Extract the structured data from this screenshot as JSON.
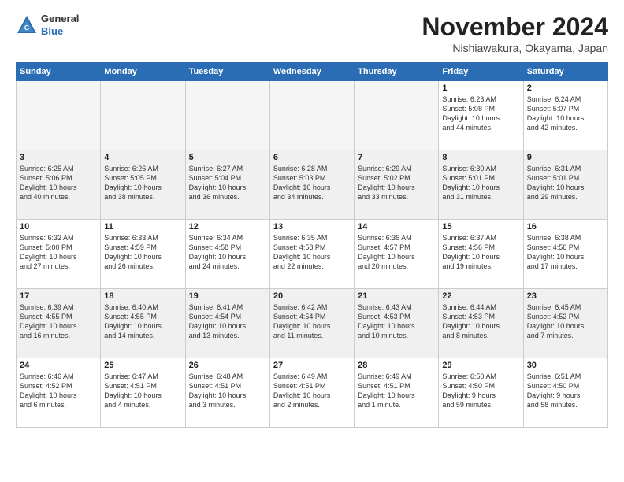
{
  "header": {
    "logo_line1": "General",
    "logo_line2": "Blue",
    "month_title": "November 2024",
    "location": "Nishiawakura, Okayama, Japan"
  },
  "weekdays": [
    "Sunday",
    "Monday",
    "Tuesday",
    "Wednesday",
    "Thursday",
    "Friday",
    "Saturday"
  ],
  "weeks": [
    [
      {
        "day": "",
        "text": ""
      },
      {
        "day": "",
        "text": ""
      },
      {
        "day": "",
        "text": ""
      },
      {
        "day": "",
        "text": ""
      },
      {
        "day": "",
        "text": ""
      },
      {
        "day": "1",
        "text": "Sunrise: 6:23 AM\nSunset: 5:08 PM\nDaylight: 10 hours\nand 44 minutes."
      },
      {
        "day": "2",
        "text": "Sunrise: 6:24 AM\nSunset: 5:07 PM\nDaylight: 10 hours\nand 42 minutes."
      }
    ],
    [
      {
        "day": "3",
        "text": "Sunrise: 6:25 AM\nSunset: 5:06 PM\nDaylight: 10 hours\nand 40 minutes."
      },
      {
        "day": "4",
        "text": "Sunrise: 6:26 AM\nSunset: 5:05 PM\nDaylight: 10 hours\nand 38 minutes."
      },
      {
        "day": "5",
        "text": "Sunrise: 6:27 AM\nSunset: 5:04 PM\nDaylight: 10 hours\nand 36 minutes."
      },
      {
        "day": "6",
        "text": "Sunrise: 6:28 AM\nSunset: 5:03 PM\nDaylight: 10 hours\nand 34 minutes."
      },
      {
        "day": "7",
        "text": "Sunrise: 6:29 AM\nSunset: 5:02 PM\nDaylight: 10 hours\nand 33 minutes."
      },
      {
        "day": "8",
        "text": "Sunrise: 6:30 AM\nSunset: 5:01 PM\nDaylight: 10 hours\nand 31 minutes."
      },
      {
        "day": "9",
        "text": "Sunrise: 6:31 AM\nSunset: 5:01 PM\nDaylight: 10 hours\nand 29 minutes."
      }
    ],
    [
      {
        "day": "10",
        "text": "Sunrise: 6:32 AM\nSunset: 5:00 PM\nDaylight: 10 hours\nand 27 minutes."
      },
      {
        "day": "11",
        "text": "Sunrise: 6:33 AM\nSunset: 4:59 PM\nDaylight: 10 hours\nand 26 minutes."
      },
      {
        "day": "12",
        "text": "Sunrise: 6:34 AM\nSunset: 4:58 PM\nDaylight: 10 hours\nand 24 minutes."
      },
      {
        "day": "13",
        "text": "Sunrise: 6:35 AM\nSunset: 4:58 PM\nDaylight: 10 hours\nand 22 minutes."
      },
      {
        "day": "14",
        "text": "Sunrise: 6:36 AM\nSunset: 4:57 PM\nDaylight: 10 hours\nand 20 minutes."
      },
      {
        "day": "15",
        "text": "Sunrise: 6:37 AM\nSunset: 4:56 PM\nDaylight: 10 hours\nand 19 minutes."
      },
      {
        "day": "16",
        "text": "Sunrise: 6:38 AM\nSunset: 4:56 PM\nDaylight: 10 hours\nand 17 minutes."
      }
    ],
    [
      {
        "day": "17",
        "text": "Sunrise: 6:39 AM\nSunset: 4:55 PM\nDaylight: 10 hours\nand 16 minutes."
      },
      {
        "day": "18",
        "text": "Sunrise: 6:40 AM\nSunset: 4:55 PM\nDaylight: 10 hours\nand 14 minutes."
      },
      {
        "day": "19",
        "text": "Sunrise: 6:41 AM\nSunset: 4:54 PM\nDaylight: 10 hours\nand 13 minutes."
      },
      {
        "day": "20",
        "text": "Sunrise: 6:42 AM\nSunset: 4:54 PM\nDaylight: 10 hours\nand 11 minutes."
      },
      {
        "day": "21",
        "text": "Sunrise: 6:43 AM\nSunset: 4:53 PM\nDaylight: 10 hours\nand 10 minutes."
      },
      {
        "day": "22",
        "text": "Sunrise: 6:44 AM\nSunset: 4:53 PM\nDaylight: 10 hours\nand 8 minutes."
      },
      {
        "day": "23",
        "text": "Sunrise: 6:45 AM\nSunset: 4:52 PM\nDaylight: 10 hours\nand 7 minutes."
      }
    ],
    [
      {
        "day": "24",
        "text": "Sunrise: 6:46 AM\nSunset: 4:52 PM\nDaylight: 10 hours\nand 6 minutes."
      },
      {
        "day": "25",
        "text": "Sunrise: 6:47 AM\nSunset: 4:51 PM\nDaylight: 10 hours\nand 4 minutes."
      },
      {
        "day": "26",
        "text": "Sunrise: 6:48 AM\nSunset: 4:51 PM\nDaylight: 10 hours\nand 3 minutes."
      },
      {
        "day": "27",
        "text": "Sunrise: 6:49 AM\nSunset: 4:51 PM\nDaylight: 10 hours\nand 2 minutes."
      },
      {
        "day": "28",
        "text": "Sunrise: 6:49 AM\nSunset: 4:51 PM\nDaylight: 10 hours\nand 1 minute."
      },
      {
        "day": "29",
        "text": "Sunrise: 6:50 AM\nSunset: 4:50 PM\nDaylight: 9 hours\nand 59 minutes."
      },
      {
        "day": "30",
        "text": "Sunrise: 6:51 AM\nSunset: 4:50 PM\nDaylight: 9 hours\nand 58 minutes."
      }
    ]
  ]
}
